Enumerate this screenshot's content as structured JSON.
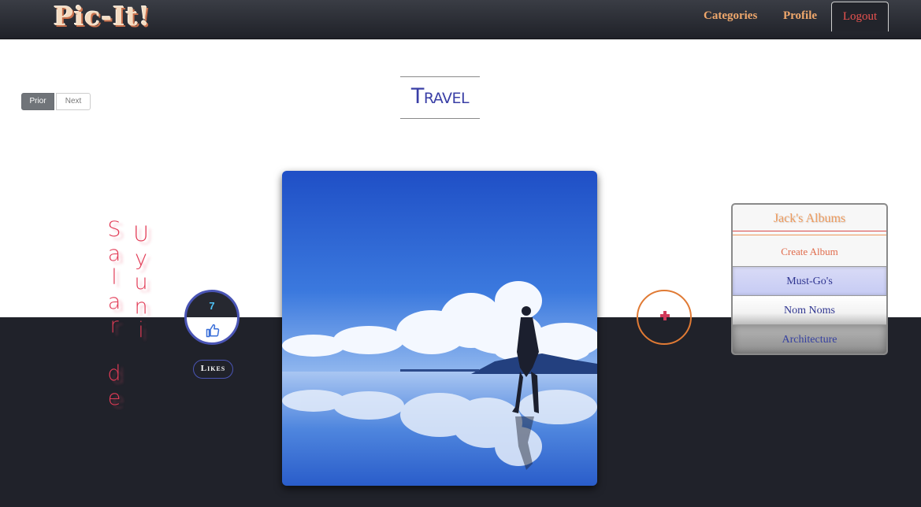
{
  "nav": {
    "logo": "Pic-It!",
    "categories": "Categories",
    "profile": "Profile",
    "logout": "Logout"
  },
  "pager": {
    "prior": "Prior",
    "next": "Next"
  },
  "page": {
    "title": "Travel"
  },
  "caption": {
    "col1": [
      "S",
      "a",
      "l",
      "a",
      "r",
      "",
      "d",
      "e"
    ],
    "col2": [
      "U",
      "y",
      "u",
      "n",
      "i"
    ]
  },
  "likes": {
    "count": "7",
    "label": "Likes",
    "thumb_icon": "thumbs-up-icon"
  },
  "add_button": {
    "icon": "plus-icon",
    "color": "#d13a5a"
  },
  "albums": {
    "title": "Jack's Albums",
    "create": "Create Album",
    "items": [
      "Must-Go's",
      "Nom Noms",
      "Architecture"
    ]
  },
  "colors": {
    "nav_bg": "#2b2d34",
    "accent_orange": "#f0a86c",
    "logout_red": "#e9524f",
    "title_blue": "#3a3fa6",
    "dark_band": "#20222a",
    "caption_red": "#e23b56"
  }
}
